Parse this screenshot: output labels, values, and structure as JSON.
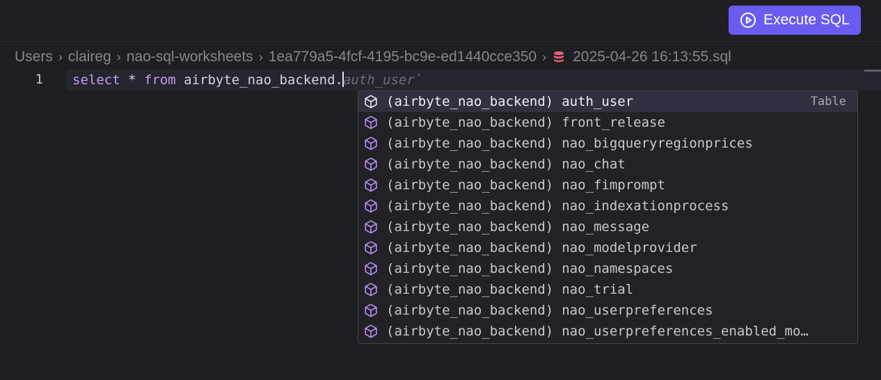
{
  "toolbar": {
    "execute_label": "Execute SQL"
  },
  "breadcrumb": {
    "items": [
      "Users",
      "claireg",
      "nao-sql-worksheets",
      "1ea779a5-4fcf-4195-bc9e-ed1440cce350",
      "2025-04-26 16:13:55.sql"
    ]
  },
  "editor": {
    "line_number": "1",
    "code": {
      "kw_select": "select",
      "star": " * ",
      "kw_from": "from",
      "typed": " airbyte_nao_backend.",
      "ghost": "auth_user`"
    }
  },
  "suggestions": {
    "schema": "(airbyte_nao_backend)",
    "selected_kind": "Table",
    "items": [
      "auth_user",
      "front_release",
      "nao_bigqueryregionprices",
      "nao_chat",
      "nao_fimprompt",
      "nao_indexationprocess",
      "nao_message",
      "nao_modelprovider",
      "nao_namespaces",
      "nao_trial",
      "nao_userpreferences",
      "nao_userpreferences_enabled_mo…"
    ]
  },
  "colors": {
    "accent": "#6a5cf0",
    "keyword": "#c49cf5",
    "table_icon": "#b48ef0",
    "db_icon": "#e0607a"
  }
}
